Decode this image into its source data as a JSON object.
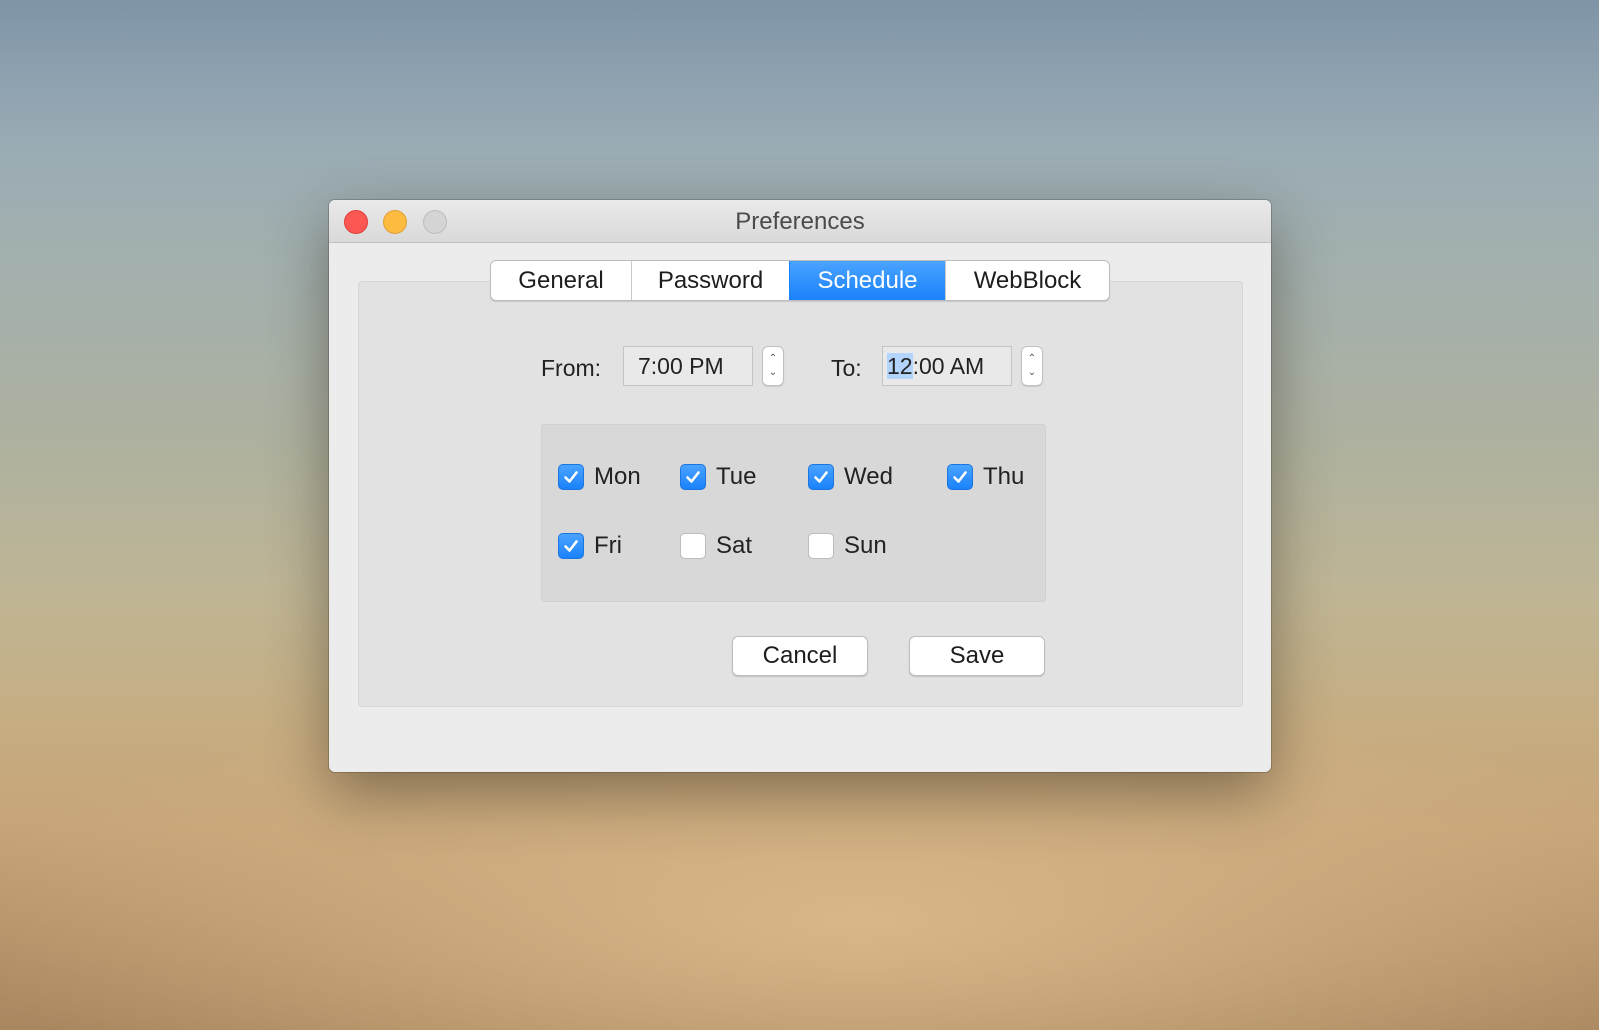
{
  "window": {
    "title": "Preferences"
  },
  "tabs": [
    {
      "label": "General",
      "selected": false
    },
    {
      "label": "Password",
      "selected": false
    },
    {
      "label": "Schedule",
      "selected": true
    },
    {
      "label": "WebBlock",
      "selected": false
    }
  ],
  "schedule": {
    "from_label": "From:",
    "from_value": "7:00 PM",
    "to_label": "To:",
    "to_value_highlight": "12",
    "to_value_rest": ":00 AM"
  },
  "days": [
    {
      "label": "Mon",
      "checked": true
    },
    {
      "label": "Tue",
      "checked": true
    },
    {
      "label": "Wed",
      "checked": true
    },
    {
      "label": "Thu",
      "checked": true
    },
    {
      "label": "Fri",
      "checked": true
    },
    {
      "label": "Sat",
      "checked": false
    },
    {
      "label": "Sun",
      "checked": false
    }
  ],
  "buttons": {
    "cancel": "Cancel",
    "save": "Save"
  },
  "colors": {
    "accent": "#1a82fb",
    "close": "#fc5753",
    "minimize": "#fdbc40",
    "zoom_disabled": "#d4d4d4"
  }
}
